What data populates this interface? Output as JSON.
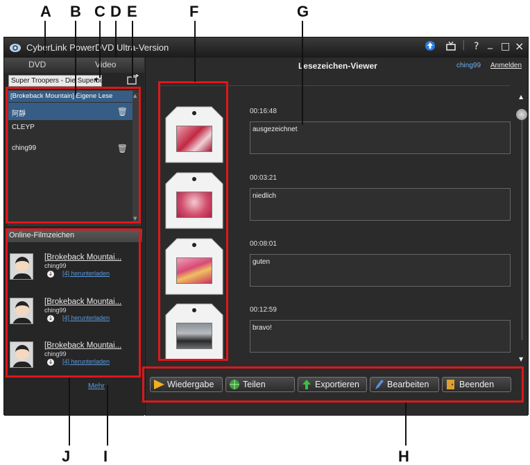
{
  "callouts": {
    "A": "A",
    "B": "B",
    "C": "C",
    "D": "D",
    "E": "E",
    "F": "F",
    "G": "G",
    "H": "H",
    "I": "I",
    "J": "J"
  },
  "window": {
    "title": "CyberLink PowerDVD  Ultra-Version",
    "buttons": [
      "?",
      "_",
      "□",
      "×"
    ]
  },
  "left_panel": {
    "tabs": [
      "DVD",
      "Video"
    ],
    "disc_select": "Super Troopers - Die Superbu",
    "bookmark_header": "[Brokeback Mountain] Eigene Lese",
    "bookmark_rows": [
      {
        "label": "阿靜",
        "has_trash": true
      },
      {
        "label": "CLEYP",
        "has_trash": false
      },
      {
        "label": "ching99",
        "has_trash": true
      }
    ],
    "online_header": "Online-Filmzeichen",
    "online_items": [
      {
        "title": "[Brokeback Mountai...",
        "user": "ching99",
        "download": "[4] herunterladen"
      },
      {
        "title": "[Brokeback Mountai...",
        "user": "ching99",
        "download": "[4] herunterladen"
      },
      {
        "title": "[Brokeback Mountai...",
        "user": "ching99",
        "download": "[4] herunterladen"
      }
    ],
    "more": "Mehr"
  },
  "viewer": {
    "title": "Lesezeichen-Viewer",
    "user": "ching99",
    "login": "Anmelden",
    "entries": [
      {
        "time": "00:16:48",
        "note": "ausgezeichnet"
      },
      {
        "time": "00:03:21",
        "note": "niedlich"
      },
      {
        "time": "00:08:01",
        "note": "guten"
      },
      {
        "time": "00:12:59",
        "note": "bravo!"
      }
    ]
  },
  "actions": [
    "Wiedergabe",
    "Teilen",
    "Exportieren",
    "Bearbeiten",
    "Beenden"
  ],
  "colors": {
    "accent_red": "#e0161a",
    "link_blue": "#5a9be0",
    "selection": "#355d86"
  }
}
